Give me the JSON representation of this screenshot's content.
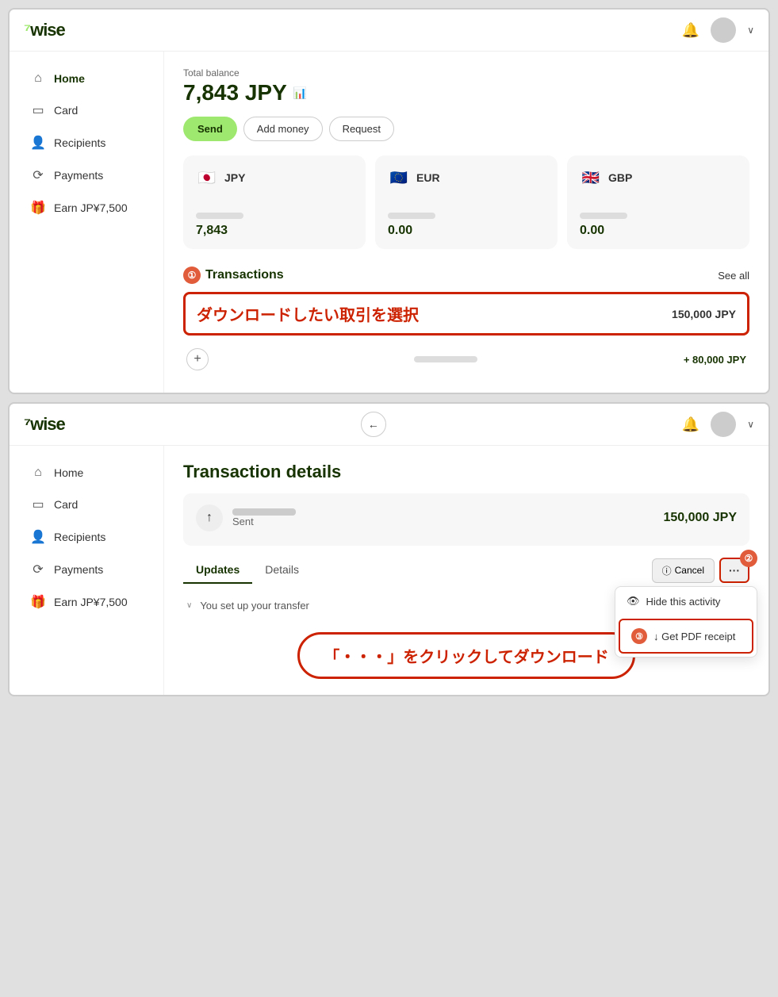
{
  "app": {
    "logo": "7wise",
    "logo_accent": "7"
  },
  "panel1": {
    "topbar": {
      "bell_label": "🔔",
      "chevron": "∨"
    },
    "sidebar": {
      "items": [
        {
          "id": "home",
          "icon": "⌂",
          "label": "Home",
          "active": true
        },
        {
          "id": "card",
          "icon": "▭",
          "label": "Card",
          "active": false
        },
        {
          "id": "recipients",
          "icon": "♟",
          "label": "Recipients",
          "active": false
        },
        {
          "id": "payments",
          "icon": "⟳",
          "label": "Payments",
          "active": false
        },
        {
          "id": "earn",
          "icon": "⊞",
          "label": "Earn JP¥7,500",
          "active": false
        }
      ]
    },
    "main": {
      "balance_label": "Total balance",
      "balance_amount": "7,843 JPY",
      "chart_icon": "📊",
      "buttons": {
        "send": "Send",
        "add_money": "Add money",
        "request": "Request"
      },
      "currencies": [
        {
          "flag": "🇯🇵",
          "code": "JPY",
          "amount": "7,843"
        },
        {
          "flag": "🇪🇺",
          "code": "EUR",
          "amount": "0.00"
        },
        {
          "flag": "🇬🇧",
          "code": "GBP",
          "amount": "0.00"
        }
      ],
      "transactions": {
        "step_number": "①",
        "title": "Transactions",
        "see_all": "See all",
        "highlight_text": "ダウンロードしたい取引を選択",
        "highlight_amount": "150,000 JPY",
        "second_row_amount": "+ 80,000 JPY"
      }
    }
  },
  "panel2": {
    "topbar": {
      "back_icon": "←",
      "bell_label": "🔔",
      "chevron": "∨"
    },
    "sidebar": {
      "items": [
        {
          "id": "home",
          "icon": "⌂",
          "label": "Home",
          "active": false
        },
        {
          "id": "card",
          "icon": "▭",
          "label": "Card",
          "active": false
        },
        {
          "id": "recipients",
          "icon": "♟",
          "label": "Recipients",
          "active": false
        },
        {
          "id": "payments",
          "icon": "⟳",
          "label": "Payments",
          "active": false
        },
        {
          "id": "earn",
          "icon": "⊞",
          "label": "Earn JP¥7,500",
          "active": false
        }
      ]
    },
    "main": {
      "page_title": "Transaction details",
      "txn_amount": "150,000 JPY",
      "txn_label": "Sent",
      "tabs": [
        {
          "id": "updates",
          "label": "Updates",
          "active": true
        },
        {
          "id": "details",
          "label": "Details",
          "active": false
        }
      ],
      "action_buttons": {
        "cancel": "Cancel",
        "three_dots": "···"
      },
      "step2_number": "②",
      "dropdown": {
        "hide_item": "Hide this activity",
        "pdf_item": "↓  Get PDF receipt"
      },
      "step3_number": "③",
      "transfer_text": "You set up your transfer",
      "bottom_annotation": "「・・・」をクリックしてダウンロード"
    }
  },
  "colors": {
    "brand_green": "#9fe870",
    "brand_dark": "#163300",
    "accent_red": "#cc2200"
  }
}
